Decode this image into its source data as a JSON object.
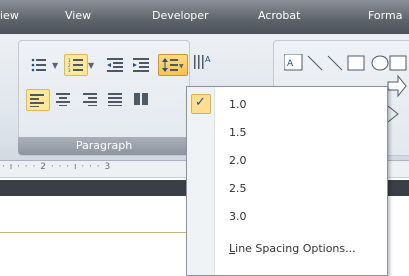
{
  "ribbon_tabs": [
    "iew",
    "View",
    "Developer",
    "Acrobat",
    "Forma"
  ],
  "paragraph_group": {
    "label": "Paragraph"
  },
  "ruler": {
    "text": "· ı · · · 2 · · · ı · · · 3"
  },
  "line_spacing_menu": {
    "items": [
      "1.0",
      "1.5",
      "2.0",
      "2.5",
      "3.0"
    ],
    "checked_item": "1.0",
    "options_label": "Line Spacing Options...",
    "options_mnemonic": "L"
  }
}
